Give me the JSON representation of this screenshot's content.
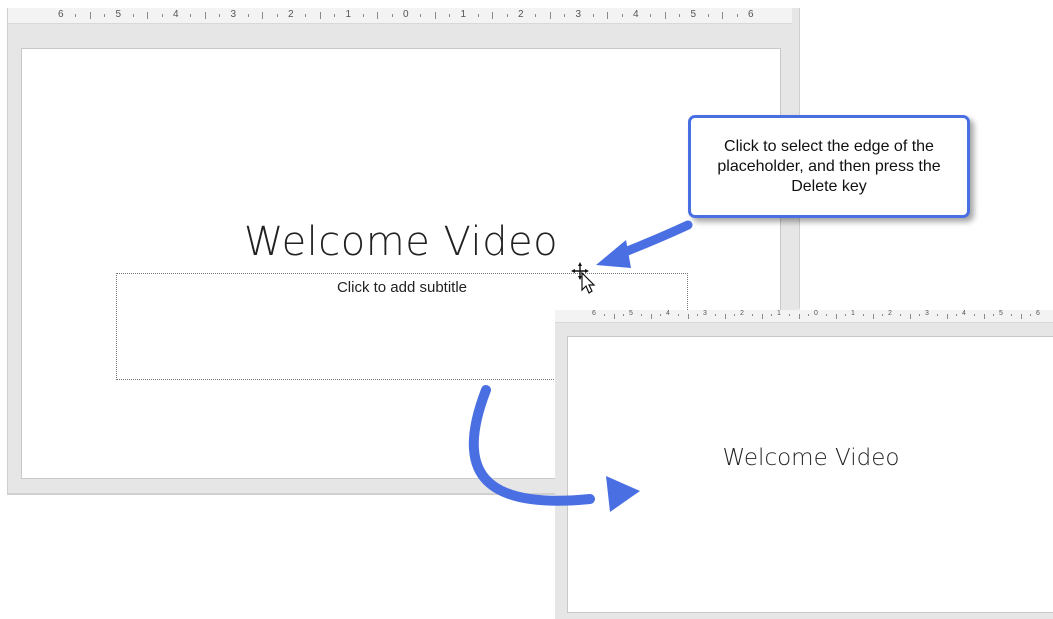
{
  "main": {
    "ruler_labels": [
      "6",
      "5",
      "4",
      "3",
      "2",
      "1",
      "0",
      "1",
      "2",
      "3",
      "4",
      "5",
      "6"
    ],
    "title": "Welcome Video",
    "subtitle_placeholder": "Click to add subtitle"
  },
  "callout": {
    "text": "Click to select the edge of the placeholder, and then press the Delete key"
  },
  "after": {
    "ruler_labels": [
      "6",
      "5",
      "4",
      "3",
      "2",
      "1",
      "0",
      "1",
      "2",
      "3",
      "4",
      "5",
      "6"
    ],
    "title": "Welcome Video"
  },
  "colors": {
    "accent_arrow": "#4a6fe3",
    "slide_bg": "#ffffff",
    "workspace_bg": "#e6e6e6"
  },
  "icons": {
    "cursor": "move-cursor-icon"
  }
}
